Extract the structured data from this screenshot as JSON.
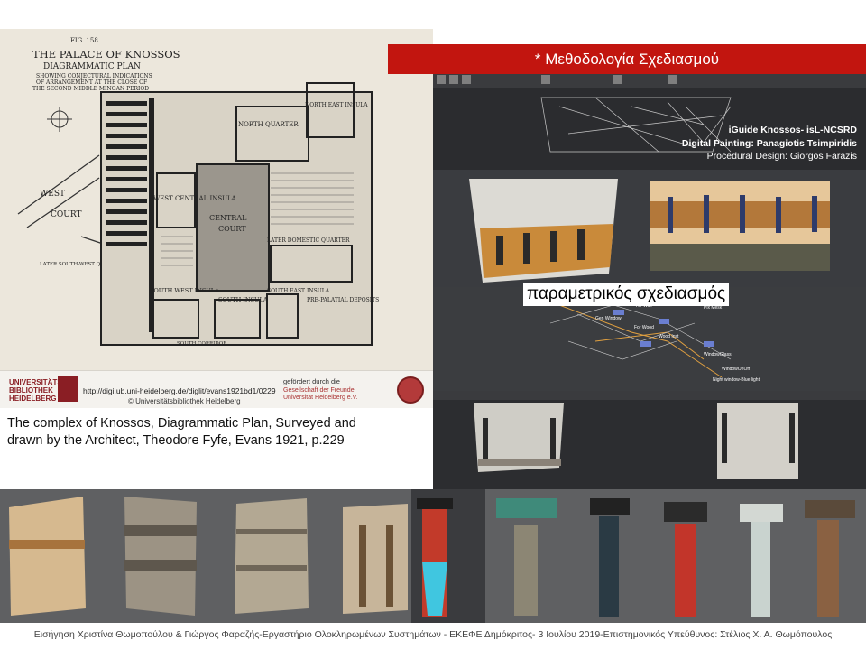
{
  "banner": {
    "title": "* Μεθοδολογία Σχεδιασμού",
    "color": "#c2150f"
  },
  "plan": {
    "fig": "FIG. 158",
    "title_1": "THE PALACE OF KNOSSOS",
    "title_2": "DIAGRAMMATIC PLAN",
    "subtitle_1": "SHOWING CONJECTURAL INDICATIONS",
    "subtitle_2": "OF ARRANGEMENT AT THE CLOSE OF",
    "subtitle_3": "THE SECOND MIDDLE MINOAN PERIOD",
    "labels": {
      "west_court": "WEST COURT",
      "west_central_insula": "WEST CENTRAL INSULA",
      "central_court": "CENTRAL COURT",
      "north_quarter": "NORTH QUARTER",
      "northeast_insula": "NORTH EAST INSULA",
      "southwest_insula": "SOUTH WEST INSULA",
      "south_insula": "SOUTH INSULA",
      "southeast_insula": "SOUTH EAST INSULA",
      "later_domestic": "LATER DOMESTIC QUARTER",
      "later_southwest": "LATER SOUTH-WEST QUARTER",
      "pre_palatial": "PRE-PALATIAL DEPOSITS",
      "south_corridor": "SOUTH CORRIDOR"
    }
  },
  "library": {
    "name_1": "UNIVERSITÄTS-",
    "name_2": "BIBLIOTHEK",
    "name_3": "HEIDELBERG",
    "url": "http://digi.ub.uni-heidelberg.de/diglit/evans1921bd1/0229",
    "copyright": "© Universitätsbibliothek Heidelberg",
    "funded_by": "gefördert durch die",
    "society_1": "Gesellschaft der Freunde",
    "society_2": "Universität Heidelberg e.V."
  },
  "caption": {
    "line_1": "The complex  of Knossos, Diagrammatic Plan, Surveyed and",
    "line_2": "drawn by the Architect, Theodore Fyfe, Evans 1921, p.229"
  },
  "credits": {
    "line_1": "iGuide Knossos- isL-NCSRD",
    "line_2": "Digital Painting: Panagiotis Tsimpiridis",
    "line_3": "Procedural Design: Giorgos Farazis"
  },
  "param_label": "παραμετρικός σχεδιασμός",
  "nodes": [
    "Wall",
    "Arr Wall",
    "Pix Mesk",
    "Gen Window",
    "For Wood",
    "Wood Inst",
    "Switch",
    "Shape2",
    "WindowGlass",
    "WindowOnOff",
    "Night window-Blue light"
  ],
  "footer": "Εισήγηση Χριστίνα Θωμοπούλου & Γιώργος Φαραζής-Εργαστήριο Ολοκληρωμένων Συστημάτων - ΕΚΕΦΕ Δημόκριτος- 3 Ιουλίου 2019-Επιστημονικός Υπεύθυνος: Στέλιος Χ. Α. Θωμόπουλος"
}
